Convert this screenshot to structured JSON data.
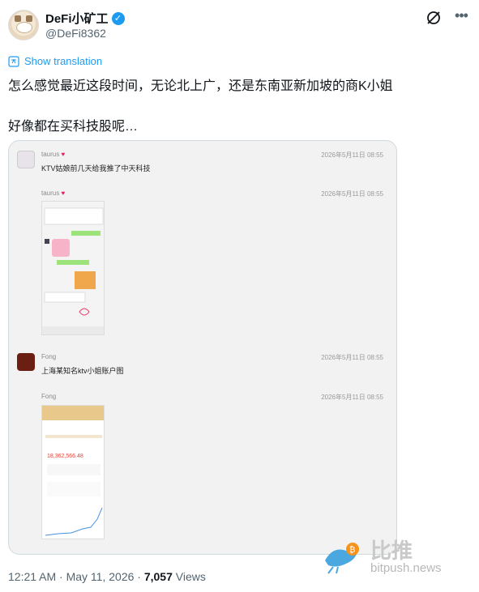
{
  "author": {
    "display_name": "DeFi小矿工",
    "handle": "@DeFi8362",
    "verified": true
  },
  "actions": {
    "grok_icon": "grok-icon",
    "more_icon": "more-icon"
  },
  "translate": {
    "label": "Show translation"
  },
  "tweet": {
    "line1": "怎么感觉最近这段时间，无论北上广，还是东南亚新加坡的商K小姐",
    "line2": "好像都在买科技股呢…"
  },
  "media": {
    "messages": [
      {
        "name": "taurus",
        "time": "2026年5月11日 08:55",
        "text": "KTV姑娘前几天给我推了中天科技"
      },
      {
        "name": "taurus",
        "time": "2026年5月11日 08:55",
        "text": ""
      },
      {
        "name": "Fong",
        "time": "2026年5月11日 08:55",
        "text": "上海某知名ktv小姐账户图"
      },
      {
        "name": "Fong",
        "time": "2026年5月11日 08:55",
        "text": ""
      }
    ],
    "account_value": "18,362,566.48"
  },
  "footer": {
    "time": "12:21 AM · May 11, 2026 · ",
    "views_count": "7,057",
    "views_label": " Views"
  },
  "watermark": {
    "cn": "比推",
    "en": "bitpush.news"
  },
  "colors": {
    "accent": "#1d9bf0",
    "text": "#0f1419",
    "muted": "#536471"
  }
}
